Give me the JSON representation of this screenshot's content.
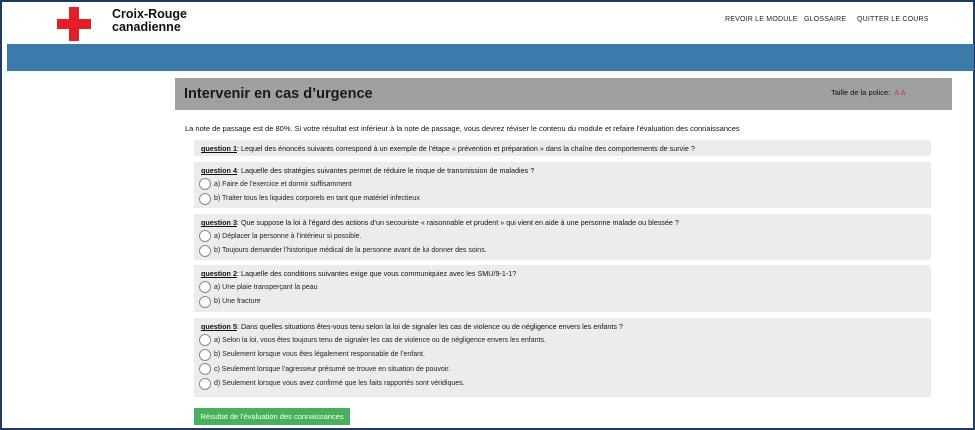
{
  "header": {
    "brand_line1": "Croix-Rouge",
    "brand_line2": "canadienne",
    "nav": [
      "REVOIR LE MODULE",
      "GLOSSAIRE",
      "QUITTER LE COURS"
    ]
  },
  "main": {
    "title": "Intervenir en cas d’urgence",
    "font_size_label": "Taille de la police:",
    "font_size_small": "A",
    "font_size_large": "A",
    "intro": "La note de passage est de 80%. Si votre résultat est inférieur à la note de passage, vous devrez réviser le contenu du module et refaire l'évaluation des connaissances",
    "questions": [
      {
        "label": "question 1",
        "text": ": Lequel des énoncés suivants correspond à un exemple de l’étape « prévention et préparation » dans la chaîne des comportements de survie ?",
        "options": []
      },
      {
        "label": "question 4",
        "text": ": Laquelle des stratégies suivantes permet de réduire le risque de transmission de maladies ?",
        "options": [
          "a) Faire de l'exercice et dormir suffisamment",
          "b) Traiter tous les liquides corporels en tant que matériel infectieux"
        ]
      },
      {
        "label": "question 3",
        "text": ": Que suppose la loi à l’égard des actions d’un secouriste « raisonnable et prudent » qui vient en aide à une personne malade ou blessée ?",
        "options": [
          "a) Déplacer la personne à l’intérieur si possible.",
          "b) Toujours demander l’historique médical de la personne avant de lui donner des soins."
        ]
      },
      {
        "label": "question 2",
        "text": ": Laquelle des conditions suivantes exige que vous communiquiez avec les SMU/9-1-1?",
        "options": [
          "a) Une plaie transperçant la peau",
          "b) Une fracture"
        ]
      },
      {
        "label": "question 5",
        "text": ": Dans quelles situations êtes-vous tenu selon la loi de signaler les cas de violence ou de négligence envers les enfants ?",
        "options": [
          "a) Selon la loi, vous êtes toujours tenu de signaler les cas de violence ou de négligence envers les enfants.",
          "b) Seulement lorsque vous êtes légalement responsable de l’enfant.",
          "c) Seulement lorsque l’agresseur présumé se trouve en situation de pouvoir.",
          "d) Seulement lorsque vous avez confirmé que les faits rapportés sont véridiques."
        ]
      }
    ],
    "submit_label": "Résultat de l'évaluation des connaissances"
  },
  "colors": {
    "brand_red": "#e41e26",
    "blue_bar": "#3b7bab",
    "title_bar": "#a0a0a0",
    "submit_green": "#47b05a"
  }
}
